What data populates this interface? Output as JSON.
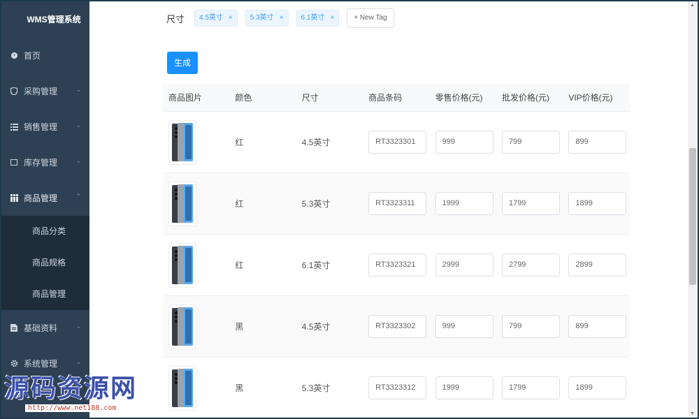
{
  "sidebar": {
    "title": "WMS管理系统",
    "items": [
      {
        "label": "首页",
        "icon": "dashboard-icon"
      },
      {
        "label": "采购管理",
        "icon": "shield-icon"
      },
      {
        "label": "销售管理",
        "icon": "list-icon"
      },
      {
        "label": "库存管理",
        "icon": "box-icon"
      },
      {
        "label": "商品管理",
        "icon": "grid-icon"
      },
      {
        "label": "基础资料",
        "icon": "document-icon"
      },
      {
        "label": "系统管理",
        "icon": "gear-icon"
      }
    ],
    "submenu": [
      "商品分类",
      "商品规格",
      "商品管理"
    ]
  },
  "tags": {
    "label": "尺寸",
    "items": [
      "4.5英寸",
      "5.3英寸",
      "6.1英寸"
    ],
    "close_glyph": "×",
    "new_tag": "+ New Tag"
  },
  "generate_button": "生成",
  "table": {
    "headers": [
      "商品图片",
      "颜色",
      "尺寸",
      "商品条码",
      "零售价格(元)",
      "批发价格(元)",
      "VIP价格(元)"
    ],
    "rows": [
      {
        "color": "红",
        "size": "4.5英寸",
        "barcode": "RT3323301",
        "retail": "999",
        "wholesale": "799",
        "vip": "899"
      },
      {
        "color": "红",
        "size": "5.3英寸",
        "barcode": "RT3323311",
        "retail": "1999",
        "wholesale": "1799",
        "vip": "1899"
      },
      {
        "color": "红",
        "size": "6.1英寸",
        "barcode": "RT3323321",
        "retail": "2999",
        "wholesale": "2799",
        "vip": "2899"
      },
      {
        "color": "黑",
        "size": "4.5英寸",
        "barcode": "RT3323302",
        "retail": "999",
        "wholesale": "799",
        "vip": "899"
      },
      {
        "color": "黑",
        "size": "5.3英寸",
        "barcode": "RT3323312",
        "retail": "1999",
        "wholesale": "1799",
        "vip": "1899"
      }
    ]
  },
  "watermark": {
    "text": "源码资源网",
    "url": "http://www.net188.com"
  },
  "colors": {
    "sidebar_bg": "#2e4054",
    "submenu_bg": "#1f2d3b",
    "primary": "#1890ff",
    "tag_bg": "#ecf5ff"
  }
}
